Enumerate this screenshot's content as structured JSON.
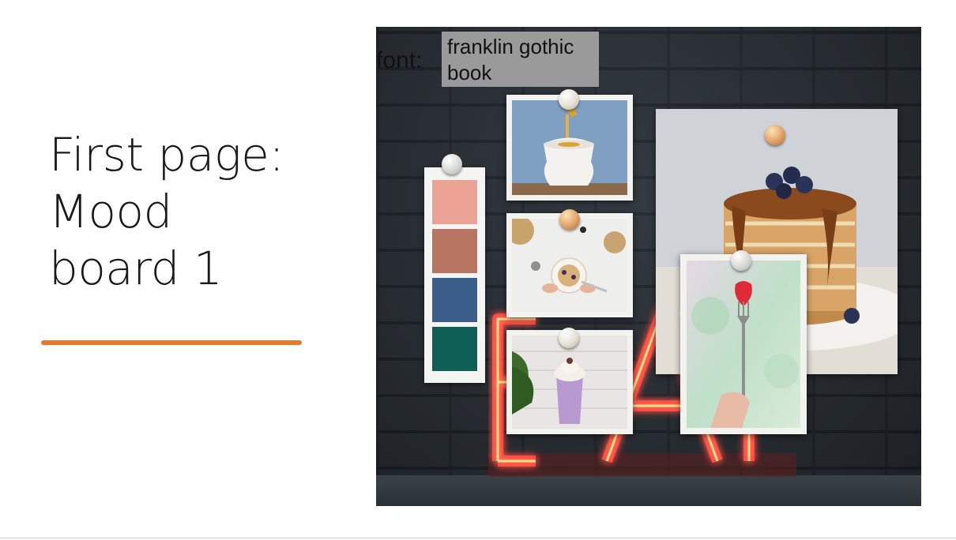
{
  "slide": {
    "title_lines": [
      "First page:",
      "Mood",
      "board 1"
    ],
    "accent_color": "#e8792a"
  },
  "moodboard": {
    "font_label": "font:",
    "font_value_lines": [
      "franklin gothic",
      "book"
    ],
    "palette": [
      "#eba393",
      "#b87562",
      "#3b5d8a",
      "#0f5f57"
    ],
    "photos": [
      "honey-drizzle-photo",
      "yogurt-bowl-photo",
      "milkshake-photo",
      "pancake-stack-photo",
      "strawberry-fork-photo"
    ],
    "icons": [
      "pushpin-icon"
    ]
  }
}
